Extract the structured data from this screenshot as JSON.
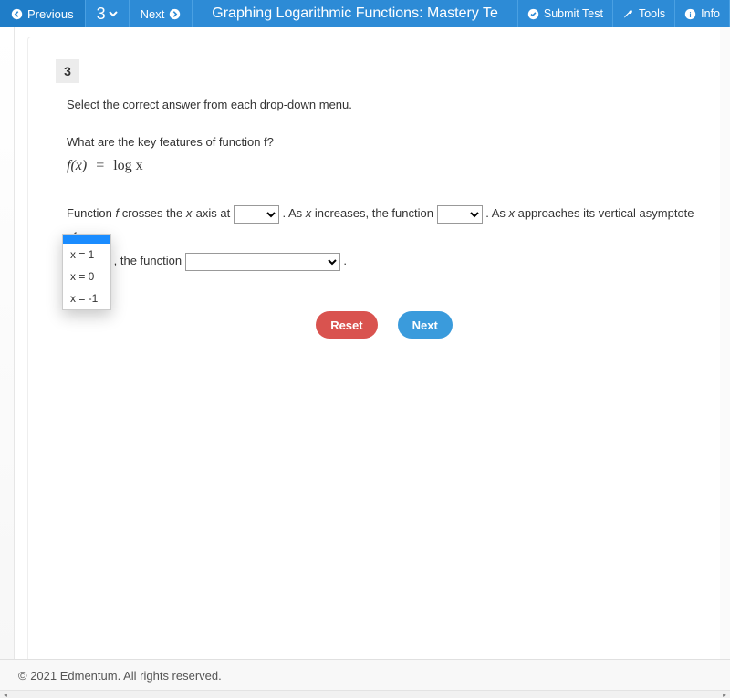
{
  "topbar": {
    "prev_label": "Previous",
    "q_num": "3",
    "next_label": "Next",
    "title": "Graphing Logarithmic Functions: Mastery Te",
    "submit_label": "Submit Test",
    "tools_label": "Tools",
    "info_label": "Info"
  },
  "question": {
    "badge": "3",
    "instruction": "Select the correct answer from each drop-down menu.",
    "prompt": "What are the key features of function f?",
    "formula_lhs": "f(x)",
    "formula_eq": "=",
    "formula_rhs": "log x",
    "cloze": {
      "seg1a": "Function ",
      "seg1f": "f",
      "seg1b": " crosses the ",
      "seg1x": "x",
      "seg1c": "-axis at ",
      "seg2a": " . As ",
      "seg2x": "x",
      "seg2b": " increases, the function ",
      "seg3a": " . As ",
      "seg3x": "x",
      "seg3b": " approaches its vertical asymptote of ",
      "seg4a": " , the function ",
      "seg4end": " ."
    },
    "dropdown1_options": [
      "",
      "x = 1",
      "x = 0",
      "x = -1"
    ],
    "dropdown_open": {
      "options": [
        "",
        "x = 1",
        "x = 0",
        "x = -1"
      ],
      "highlighted_index": 0
    }
  },
  "actions": {
    "reset_label": "Reset",
    "next_label": "Next"
  },
  "footer": {
    "copyright": "© 2021 Edmentum. All rights reserved."
  }
}
